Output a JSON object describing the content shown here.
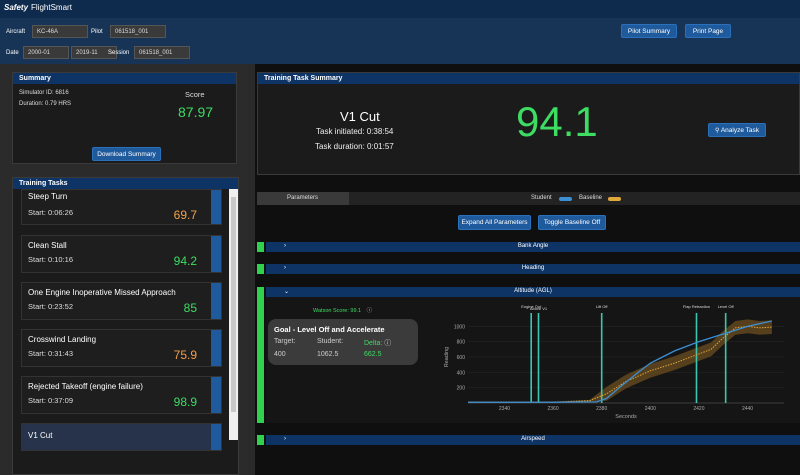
{
  "header": {
    "brand": "Safety",
    "app_name": "FlightSmart"
  },
  "filters": {
    "aircraft_label": "Aircraft",
    "aircraft_value": "KC-46A",
    "pilot_label": "Pilot",
    "pilot_value": "061518_001",
    "date_label": "Date",
    "date_from": "2000-01",
    "date_to": "2019-11",
    "session_label": "Session",
    "session_value": "061518_001",
    "pilot_summary_label": "Pilot Summary",
    "print_page_label": "Print Page"
  },
  "summary": {
    "title": "Summary",
    "simulator_id": "Simulator ID: 6816",
    "duration": "Duration: 0.79 HRS",
    "score_label": "Score",
    "score_value": "87.97",
    "download_label": "Download Summary"
  },
  "training_tasks": {
    "title": "Training Tasks",
    "items": [
      {
        "name": "Steep Turn",
        "start": "Start: 0:06:26",
        "score": "69.7",
        "color": "#f2a24a"
      },
      {
        "name": "Clean Stall",
        "start": "Start: 0:10:16",
        "score": "94.2",
        "color": "#3ddc62"
      },
      {
        "name": "One Engine Inoperative Missed Approach",
        "start": "Start: 0:23:52",
        "score": "85",
        "color": "#3ddc62"
      },
      {
        "name": "Crosswind Landing",
        "start": "Start: 0:31:43",
        "score": "75.9",
        "color": "#f2a24a"
      },
      {
        "name": "Rejected Takeoff (engine failure)",
        "start": "Start: 0:37:09",
        "score": "98.9",
        "color": "#3ddc62"
      },
      {
        "name": "V1 Cut",
        "start": "",
        "score": "",
        "color": "#3ddc62"
      }
    ]
  },
  "task_summary": {
    "title": "Training Task Summary",
    "task_name": "V1 Cut",
    "initiated": "Task initiated: 0:38:54",
    "duration": "Task duration: 0:01:57",
    "score": "94.1",
    "analyze_label": "Analyze Task"
  },
  "parameters": {
    "tab_label": "Parameters",
    "student_label": "Student",
    "baseline_label": "Baseline",
    "student_color": "#3d8fd4",
    "baseline_color": "#e0a83a",
    "expand_label": "Expand All Parameters",
    "toggle_label": "Toggle Baseline Off"
  },
  "sections": {
    "bank_angle": "Bank Angle",
    "heading": "Heading",
    "altitude": "Altitude (AGL)",
    "airspeed": "Airspeed"
  },
  "altitude_detail": {
    "watson_score": "Watson Score: 99.1",
    "goal_title": "Goal - Level Off and Accelerate",
    "target_label": "Target:",
    "target_value": "400",
    "student_label": "Student:",
    "student_value": "1062.5",
    "delta_label": "Delta:",
    "delta_value": "662.5"
  },
  "chart_data": {
    "type": "line",
    "xlabel": "Seconds",
    "ylabel": "Reading",
    "xlim": [
      2325,
      2455
    ],
    "ylim": [
      0,
      1200
    ],
    "x_ticks": [
      2340,
      2360,
      2380,
      2400,
      2420,
      2440
    ],
    "y_ticks": [
      200,
      400,
      600,
      800,
      1000
    ],
    "annotations": [
      {
        "x": 2351,
        "label": "Engine Out"
      },
      {
        "x": 2354,
        "label": "Above V1"
      },
      {
        "x": 2380,
        "label": "Lift Off"
      },
      {
        "x": 2419,
        "label": "Flap Retraction"
      },
      {
        "x": 2431,
        "label": "Level Off"
      }
    ],
    "series": [
      {
        "name": "Student",
        "x": [
          2325,
          2360,
          2378,
          2382,
          2388,
          2395,
          2400,
          2405,
          2410,
          2420,
          2430,
          2440,
          2450
        ],
        "y": [
          10,
          10,
          15,
          60,
          220,
          400,
          520,
          600,
          680,
          800,
          900,
          1000,
          1070
        ]
      },
      {
        "name": "Baseline",
        "x": [
          2325,
          2360,
          2375,
          2382,
          2390,
          2400,
          2410,
          2420,
          2425,
          2430,
          2435,
          2440,
          2445,
          2450
        ],
        "y": [
          10,
          10,
          30,
          120,
          280,
          420,
          520,
          640,
          700,
          850,
          980,
          1000,
          980,
          990
        ]
      }
    ]
  }
}
